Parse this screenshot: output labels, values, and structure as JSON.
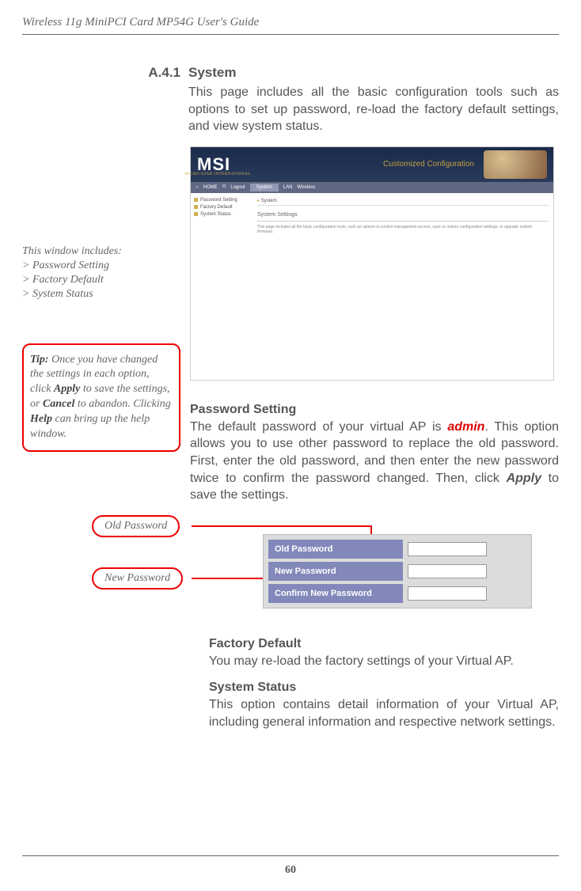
{
  "header": "Wireless 11g MiniPCI Card MP54G User's Guide",
  "section": {
    "num": "A.4.1",
    "title": "System",
    "intro": "This page includes all the basic configuration tools such as options to set up password, re-load the factory default settings, and view system status."
  },
  "sidebar": {
    "includes_title": "This window includes:",
    "items": [
      "Password Setting",
      "Factory Default",
      "System Status"
    ]
  },
  "tip": {
    "label": "Tip:",
    "text_a": " Once you have changed the settings in each option, click ",
    "apply": "Apply",
    "text_b": " to save the settings, or ",
    "cancel": "Cancel",
    "text_c": " to abandon. Clicking ",
    "help": "Help",
    "text_d": " can bring up the help window."
  },
  "shot1": {
    "logo": "MSI",
    "logo_sub": "MICRO-STAR INTERNATIONAL",
    "cust": "Customized Configuration",
    "tabs": {
      "home": "HOME",
      "logout": "Logout",
      "system": "System",
      "lan": "LAN",
      "wireless": "Wireless"
    },
    "side_items": [
      "Password Setting",
      "Factory Default",
      "System Status"
    ],
    "crumb_arrow": "▸",
    "crumb": "System",
    "panel_title": "System Settings",
    "panel_text": "This page includes all the basic configuration tools, such as options to control management access, save or restore configuration settings, or upgrade system firmware."
  },
  "password_section": {
    "title": "Password Setting",
    "text_a": "The default password of your virtual AP is ",
    "admin": "admin",
    "text_b": ".  This option allows you to use other password to replace the old password.  First, enter the old password, and then enter the new password twice to confirm the password changed.  Then, click ",
    "apply": "Apply",
    "text_c": " to save the settings."
  },
  "callouts": {
    "old": "Old Password",
    "new": "New Password"
  },
  "shot2": {
    "row1": "Old Password",
    "row2": "New Password",
    "row3": "Confirm New Password"
  },
  "factory": {
    "title": "Factory Default",
    "text": "You may re-load the factory settings of your Virtual AP."
  },
  "status": {
    "title": "System Status",
    "text": "This option contains detail information of your Virtual AP, including general information and respective network settings."
  },
  "page_num": "60"
}
